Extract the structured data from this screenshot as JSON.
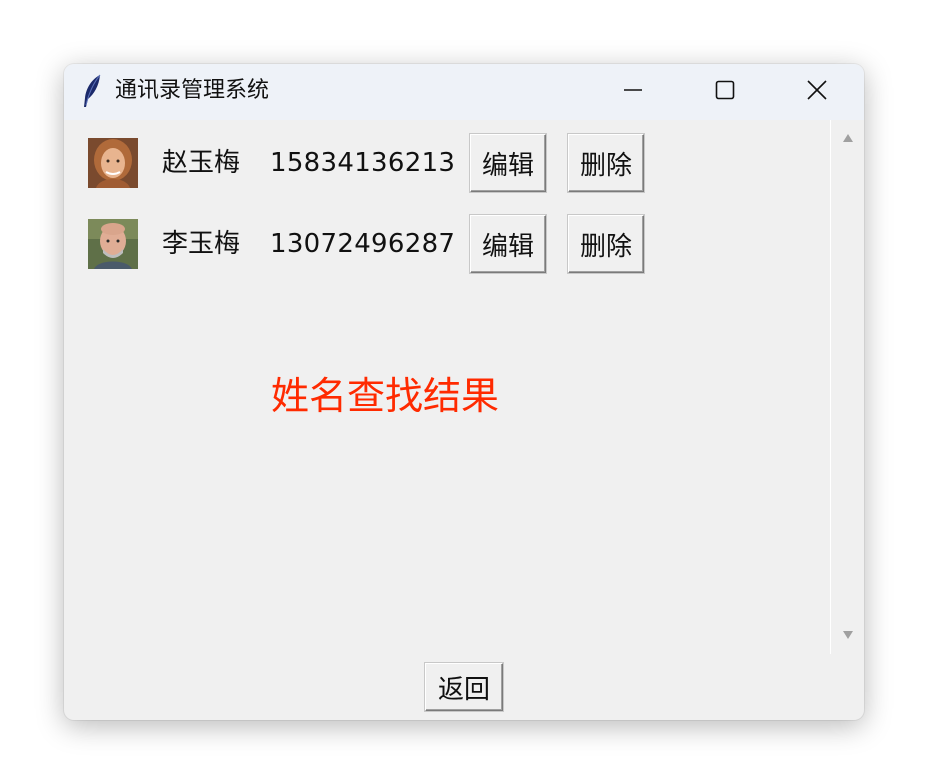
{
  "window": {
    "title": "通讯录管理系统",
    "icon": "feather-icon",
    "controls": {
      "minimize": "minimize-icon",
      "maximize": "maximize-icon",
      "close": "close-icon"
    }
  },
  "contacts": [
    {
      "name": "赵玉梅",
      "phone": "15834136213",
      "edit_label": "编辑",
      "delete_label": "删除",
      "avatar": "female-avatar"
    },
    {
      "name": "李玉梅",
      "phone": "13072496287",
      "edit_label": "编辑",
      "delete_label": "删除",
      "avatar": "male-avatar"
    }
  ],
  "result": {
    "label": "姓名查找结果",
    "color": "#ff2a00"
  },
  "footer": {
    "back_label": "返回"
  },
  "scrollbar": {
    "up": "scroll-up-arrow-icon",
    "down": "scroll-down-arrow-icon"
  }
}
